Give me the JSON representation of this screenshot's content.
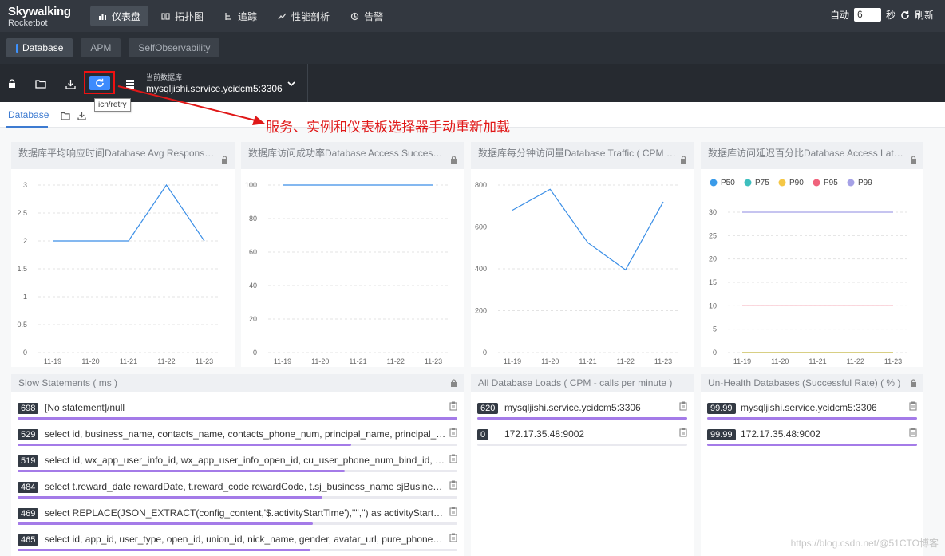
{
  "app": {
    "brand": "Skywalking",
    "subtitle": "Rocketbot"
  },
  "nav": [
    {
      "label": "仪表盘",
      "icon": "dashboard-icon",
      "active": true
    },
    {
      "label": "拓扑图",
      "icon": "topology-icon"
    },
    {
      "label": "追踪",
      "icon": "trace-icon"
    },
    {
      "label": "性能剖析",
      "icon": "profile-icon"
    },
    {
      "label": "告警",
      "icon": "alarm-icon"
    }
  ],
  "auto": {
    "label": "自动",
    "value": "6",
    "unit": "秒",
    "refresh_label": "刷新"
  },
  "subtabs": [
    "Database",
    "APM",
    "SelfObservability"
  ],
  "toolbar": {
    "db_label": "当前数据库",
    "db_value": "mysqljishi.service.ycidcm5:3306",
    "tooltip": "icn/retry"
  },
  "annotation": "服务、实例和仪表板选择器手动重新加载",
  "dashboard_tab": "Database",
  "charts": [
    {
      "title": "数据库平均响应时间Database Avg Response Time ..."
    },
    {
      "title": "数据库访问成功率Database Access Successful Rat..."
    },
    {
      "title": "数据库每分钟访问量Database Traffic ( CPM - calls ..."
    },
    {
      "title": "数据库访问延迟百分比Database Access Latency Pe..."
    }
  ],
  "chart_data": [
    {
      "type": "line",
      "categories": [
        "11-19",
        "11-20",
        "11-21",
        "11-22",
        "11-23"
      ],
      "y_ticks": [
        "0",
        "0.5",
        "1",
        "1.5",
        "2",
        "2.5",
        "3"
      ],
      "ylim": [
        0,
        3
      ],
      "series": [
        {
          "values": [
            2,
            2,
            2,
            3,
            2
          ],
          "color": "#3a8ee6"
        }
      ]
    },
    {
      "type": "line",
      "categories": [
        "11-19",
        "11-20",
        "11-21",
        "11-22",
        "11-23"
      ],
      "y_ticks": [
        "0",
        "20",
        "40",
        "60",
        "80",
        "100"
      ],
      "ylim": [
        0,
        100
      ],
      "series": [
        {
          "values": [
            100,
            100,
            100,
            100,
            100
          ],
          "color": "#3a8ee6"
        }
      ]
    },
    {
      "type": "line",
      "categories": [
        "11-19",
        "11-20",
        "11-21",
        "11-22",
        "11-23"
      ],
      "y_ticks": [
        "0",
        "200",
        "400",
        "600",
        "800"
      ],
      "ylim": [
        0,
        800
      ],
      "series": [
        {
          "values": [
            680,
            780,
            525,
            395,
            720
          ],
          "color": "#3a8ee6"
        }
      ]
    },
    {
      "type": "line",
      "categories": [
        "11-19",
        "11-20",
        "11-21",
        "11-22",
        "11-23"
      ],
      "y_ticks": [
        "0",
        "5",
        "10",
        "15",
        "20",
        "25",
        "30"
      ],
      "ylim": [
        0,
        30
      ],
      "legend": "top-left",
      "series": [
        {
          "name": "P50",
          "color": "#3a9be9",
          "values": [
            0,
            0,
            0,
            0,
            0
          ]
        },
        {
          "name": "P75",
          "color": "#3ebfbe",
          "values": [
            0,
            0,
            0,
            0,
            0
          ]
        },
        {
          "name": "P90",
          "color": "#f5c746",
          "values": [
            0,
            0,
            0,
            0,
            0
          ]
        },
        {
          "name": "P95",
          "color": "#f0637c",
          "values": [
            10,
            10,
            10,
            10,
            10
          ]
        },
        {
          "name": "P99",
          "color": "#a5a1e6",
          "values": [
            30,
            30,
            30,
            30,
            30
          ]
        }
      ]
    }
  ],
  "slow": {
    "title": "Slow Statements ( ms )",
    "rows": [
      {
        "value": "698",
        "text": "[No statement]/null",
        "pct": 1.0
      },
      {
        "value": "529",
        "text": "select id, business_name, contacts_name, contacts_phone_num, principal_name, principal_id_nu...",
        "pct": 0.758
      },
      {
        "value": "519",
        "text": "select id, wx_app_user_info_id, wx_app_user_info_open_id, cu_user_phone_num_bind_id, js_user_...",
        "pct": 0.744
      },
      {
        "value": "484",
        "text": "select t.reward_date rewardDate, t.reward_code rewardCode, t.sj_business_name sjBusinessNam...",
        "pct": 0.693
      },
      {
        "value": "469",
        "text": "select REPLACE(JSON_EXTRACT(config_content,'$.activityStartTime'),'\"','') as activityStartTime, R...",
        "pct": 0.672
      },
      {
        "value": "465",
        "text": "select id, app_id, user_type, open_id, union_id, nick_name, gender, avatar_url, pure_phone_num...",
        "pct": 0.666
      }
    ]
  },
  "loads": {
    "title": "All Database Loads ( CPM - calls per minute )",
    "rows": [
      {
        "value": "620",
        "text": "mysqljishi.service.ycidcm5:3306",
        "pct": 1.0
      },
      {
        "value": "0",
        "text": "172.17.35.48:9002",
        "pct": 0
      }
    ]
  },
  "unhealth": {
    "title": "Un-Health Databases (Successful Rate) ( % )",
    "rows": [
      {
        "value": "99.99",
        "text": "mysqljishi.service.ycidcm5:3306",
        "pct": 1.0
      },
      {
        "value": "99.99",
        "text": "172.17.35.48:9002",
        "pct": 1.0
      }
    ]
  },
  "watermark": "https://blog.csdn.net/@51CTO博客"
}
